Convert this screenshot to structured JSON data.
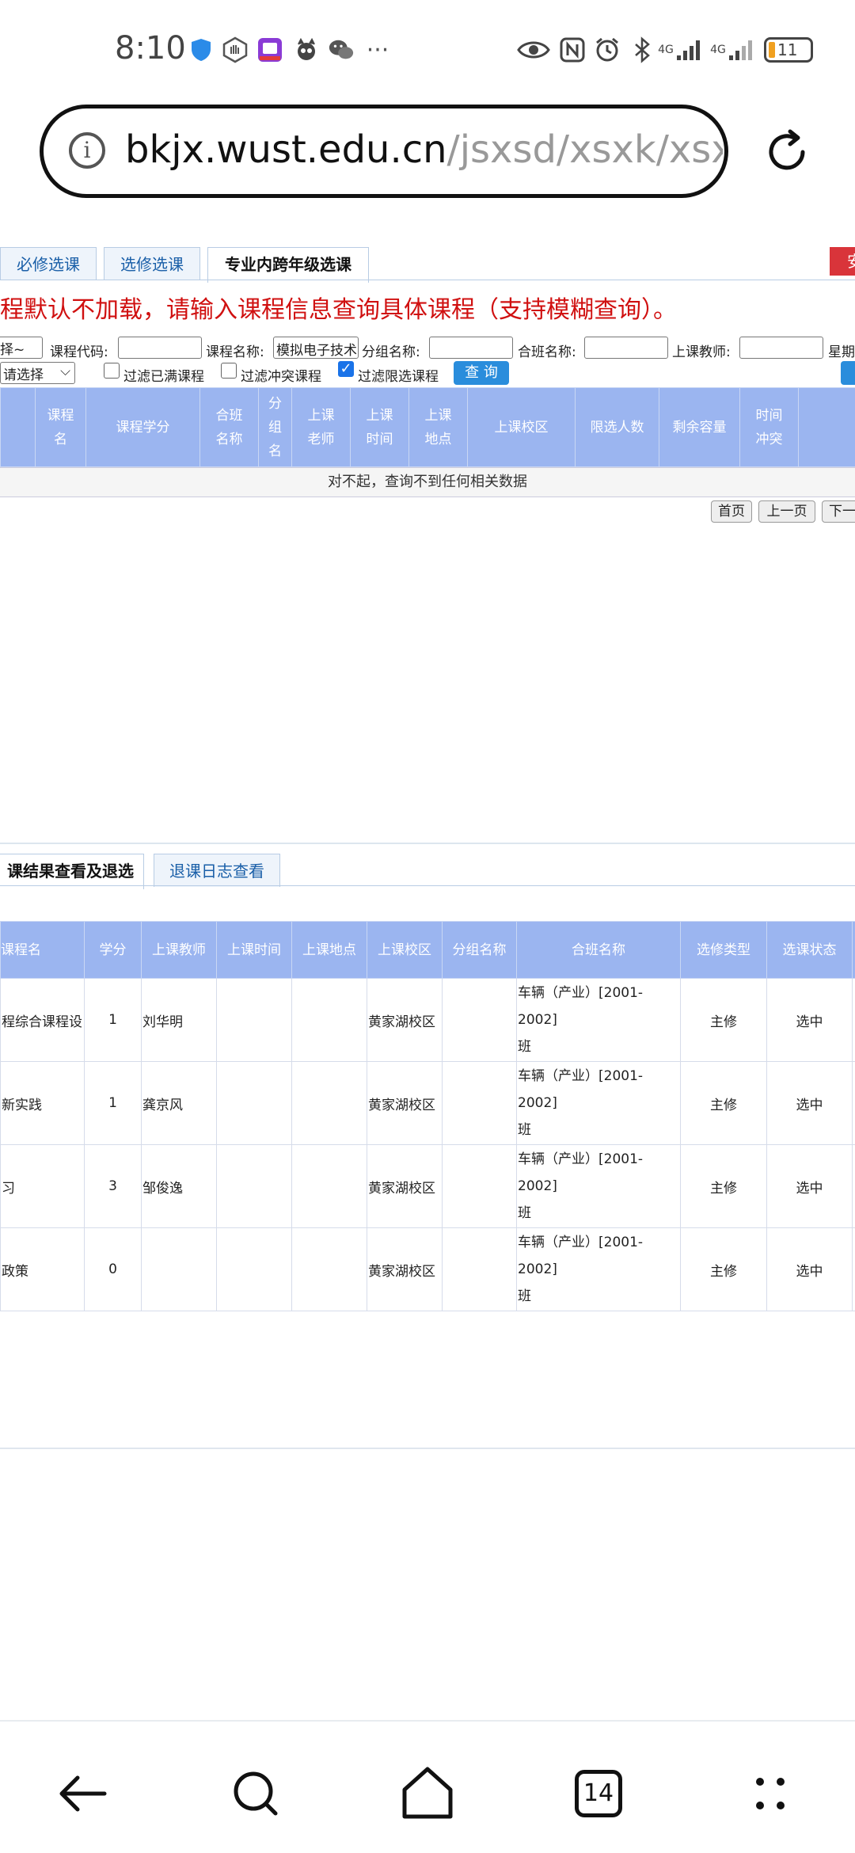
{
  "status_bar": {
    "time": "8:10",
    "network_1": "4G",
    "network_2": "4G",
    "battery": "11"
  },
  "address_bar": {
    "domain": "bkjx.wust.edu.cn",
    "path": "/jsxsd/xsxk/xsxk_i"
  },
  "tabs": [
    {
      "label": "必修选课",
      "active": false
    },
    {
      "label": "选修选课",
      "active": false
    },
    {
      "label": "专业内跨年级选课",
      "active": true
    }
  ],
  "red_button_label": "安",
  "notice": "程默认不加载，请输入课程信息查询具体课程（支持模糊查询）。",
  "filters": {
    "select1": "择~",
    "course_code_label": "课程代码:",
    "course_code_value": "",
    "course_name_label": "课程名称:",
    "course_name_value": "模拟电子技术",
    "group_name_label": "分组名称:",
    "group_name_value": "",
    "merged_class_label": "合班名称:",
    "merged_class_value": "",
    "teacher_label": "上课教师:",
    "teacher_value": "",
    "weekday_label": "星期",
    "select2": "请选择",
    "filter_full_label": "过滤已满课程",
    "filter_full_checked": false,
    "filter_conflict_label": "过滤冲突课程",
    "filter_conflict_checked": false,
    "filter_limited_label": "过滤限选课程",
    "filter_limited_checked": true,
    "query_label": "查 询"
  },
  "course_table": {
    "headers": [
      "课程名",
      "课程学分",
      "合班名称",
      "分组名",
      "上课老师",
      "上课时间",
      "上课地点",
      "上课校区",
      "限选人数",
      "剩余容量",
      "时间冲突"
    ],
    "empty_message": "对不起，查询不到任何相关数据"
  },
  "pagination": {
    "first": "首页",
    "prev": "上一页",
    "next": "下一"
  },
  "bottom_tabs": [
    {
      "label": "课结果查看及退选",
      "active": true
    },
    {
      "label": "退课日志查看",
      "active": false
    }
  ],
  "result_table": {
    "headers": [
      "课程名",
      "学分",
      "上课教师",
      "上课时间",
      "上课地点",
      "上课校区",
      "分组名称",
      "合班名称",
      "选修类型",
      "选课状态"
    ],
    "rows": [
      {
        "name": "程综合课程设",
        "credit": "1",
        "teacher": "刘华明",
        "time": "",
        "place": "",
        "campus": "黄家湖校区",
        "group": "",
        "merged_line1": "车辆（产业）[2001-2002]",
        "merged_line2": "班",
        "type": "主修",
        "status": "选中"
      },
      {
        "name": "新实践",
        "credit": "1",
        "teacher": "龚京风",
        "time": "",
        "place": "",
        "campus": "黄家湖校区",
        "group": "",
        "merged_line1": "车辆（产业）[2001-2002]",
        "merged_line2": "班",
        "type": "主修",
        "status": "选中"
      },
      {
        "name": "习",
        "credit": "3",
        "teacher": "邹俊逸",
        "time": "",
        "place": "",
        "campus": "黄家湖校区",
        "group": "",
        "merged_line1": "车辆（产业）[2001-2002]",
        "merged_line2": "班",
        "type": "主修",
        "status": "选中"
      },
      {
        "name": "政策",
        "credit": "0",
        "teacher": "",
        "time": "",
        "place": "",
        "campus": "黄家湖校区",
        "group": "",
        "merged_line1": "车辆（产业）[2001-2002]",
        "merged_line2": "班",
        "type": "主修",
        "status": "选中"
      }
    ]
  },
  "nav": {
    "tab_count": "14"
  },
  "colors": {
    "table_header": "#9bb5f0",
    "notice_red": "#d01010",
    "query_button": "#2a8ddc",
    "tab_text": "#1a5fa8"
  }
}
